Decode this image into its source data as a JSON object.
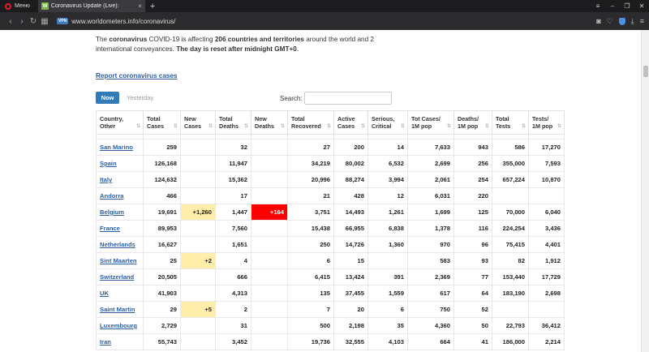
{
  "browser": {
    "menu_label": "Меню",
    "tab": {
      "favicon": "W",
      "title": "Coronavirus Update (Live):"
    },
    "url": "www.worldometers.info/coronavirus/",
    "vpn_label": "VPN"
  },
  "icons": {
    "close": "×",
    "new_tab": "+",
    "back": "‹",
    "forward": "›",
    "reload": "↻",
    "grid": "▦",
    "camera": "◙",
    "heart": "♡",
    "download": "⤓",
    "settings": "≡",
    "minimize": "–",
    "maximize": "❐",
    "win_close": "✕",
    "sort": "⇅"
  },
  "page": {
    "intro": {
      "p1": "The ",
      "b1": "coronavirus",
      "p2": " COVID-19 is affecting ",
      "b2": "206 countries and territories",
      "p3": " around the world and 2 international conveyances. ",
      "b3": "The day is reset after midnight GMT+0",
      "p4": "."
    },
    "report_link": "Report coronavirus cases",
    "toggle": {
      "now": "Now",
      "yesterday": "Yesterday"
    },
    "search_label": "Search:",
    "search_value": ""
  },
  "table": {
    "headers": [
      [
        "Country,",
        "Other"
      ],
      [
        "Total",
        "Cases"
      ],
      [
        "New",
        "Cases"
      ],
      [
        "Total",
        "Deaths"
      ],
      [
        "New",
        "Deaths"
      ],
      [
        "Total",
        "Recovered"
      ],
      [
        "Active",
        "Cases"
      ],
      [
        "Serious,",
        "Critical"
      ],
      [
        "Tot Cases/",
        "1M pop"
      ],
      [
        "Deaths/",
        "1M pop"
      ],
      [
        "Total",
        "Tests"
      ],
      [
        "Tests/",
        "1M pop"
      ]
    ],
    "rows": [
      [
        "San Marino",
        "259",
        "",
        "32",
        "",
        "27",
        "200",
        "14",
        "7,633",
        "943",
        "586",
        "17,270"
      ],
      [
        "Spain",
        "126,168",
        "",
        "11,947",
        "",
        "34,219",
        "80,002",
        "6,532",
        "2,699",
        "256",
        "355,000",
        "7,593"
      ],
      [
        "Italy",
        "124,632",
        "",
        "15,362",
        "",
        "20,996",
        "88,274",
        "3,994",
        "2,061",
        "254",
        "657,224",
        "10,870"
      ],
      [
        "Andorra",
        "466",
        "",
        "17",
        "",
        "21",
        "428",
        "12",
        "6,031",
        "220",
        "",
        ""
      ],
      [
        "Belgium",
        "19,691",
        "+1,260",
        "1,447",
        "+164",
        "3,751",
        "14,493",
        "1,261",
        "1,699",
        "125",
        "70,000",
        "6,040"
      ],
      [
        "France",
        "89,953",
        "",
        "7,560",
        "",
        "15,438",
        "66,955",
        "6,838",
        "1,378",
        "116",
        "224,254",
        "3,436"
      ],
      [
        "Netherlands",
        "16,627",
        "",
        "1,651",
        "",
        "250",
        "14,726",
        "1,360",
        "970",
        "96",
        "75,415",
        "4,401"
      ],
      [
        "Sint Maarten",
        "25",
        "+2",
        "4",
        "",
        "6",
        "15",
        "",
        "583",
        "93",
        "82",
        "1,912"
      ],
      [
        "Switzerland",
        "20,505",
        "",
        "666",
        "",
        "6,415",
        "13,424",
        "391",
        "2,369",
        "77",
        "153,440",
        "17,729"
      ],
      [
        "UK",
        "41,903",
        "",
        "4,313",
        "",
        "135",
        "37,455",
        "1,559",
        "617",
        "64",
        "183,190",
        "2,698"
      ],
      [
        "Saint Martin",
        "29",
        "+5",
        "2",
        "",
        "7",
        "20",
        "6",
        "750",
        "52",
        "",
        ""
      ],
      [
        "Luxembourg",
        "2,729",
        "",
        "31",
        "",
        "500",
        "2,198",
        "35",
        "4,360",
        "50",
        "22,793",
        "36,412"
      ],
      [
        "Iran",
        "55,743",
        "",
        "3,452",
        "",
        "19,736",
        "32,555",
        "4,103",
        "664",
        "41",
        "186,000",
        "2,214"
      ]
    ],
    "colors": {
      "new_cases_hl": "#ffeeaa",
      "new_deaths_hl": "#ff0000",
      "link": "#2a5ea5",
      "now_btn": "#337ab7"
    }
  }
}
